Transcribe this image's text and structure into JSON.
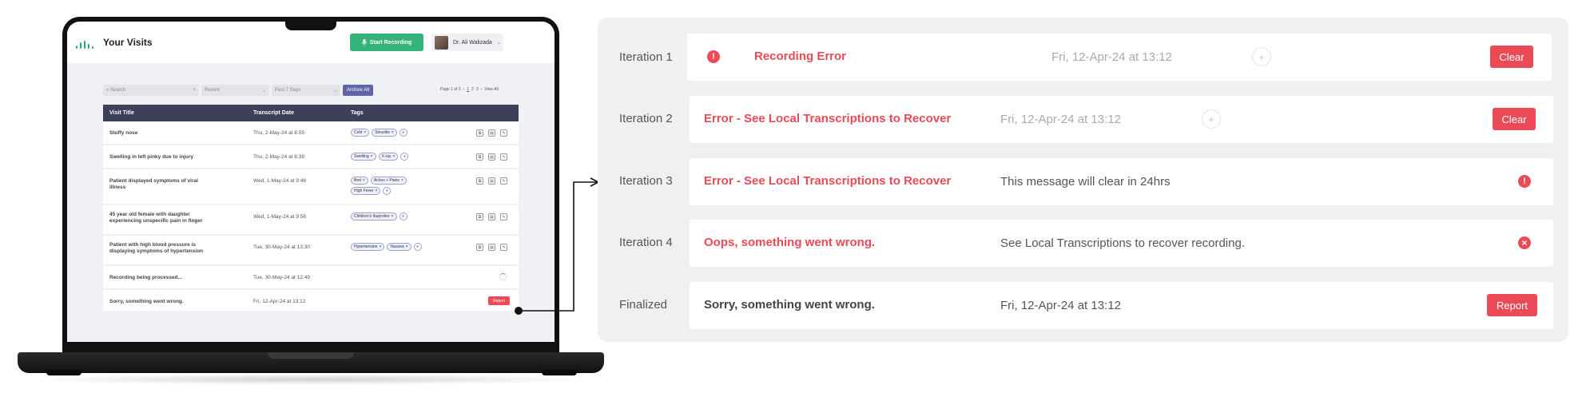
{
  "app": {
    "title": "Your Visits",
    "start_button": "Start Recording",
    "user_name": "Dr. Ali Walizada",
    "search_placeholder": "Search",
    "filter_sort": "Recent",
    "filter_range": "Past 7 Days",
    "archive_button": "Archive All",
    "pager": {
      "label": "Page 1 of 3",
      "pages": [
        "1",
        "2",
        "3"
      ],
      "view_all": "View All"
    },
    "columns": [
      "Visit Title",
      "Transcript Date",
      "Tags"
    ],
    "rows": [
      {
        "title": "Stuffy nose",
        "date": "Thu, 2-May-24 at 8:55",
        "tags": [
          "Cold",
          "Sinusitis"
        ]
      },
      {
        "title": "Swelling in left pinky due to injury",
        "date": "Thu, 2-May-24 at 8:39",
        "tags": [
          "Swelling",
          "X-ray"
        ]
      },
      {
        "title": "Patient displayed symptoms of viral illness",
        "date": "Wed, 1-May-24 at 9:46",
        "tags": [
          "Bed",
          "Aches + Pains",
          "High Fever"
        ]
      },
      {
        "title": "45 year old female with daughter experiencing unspecific pain in finger",
        "date": "Wed, 1-May-24 at 9:56",
        "tags": [
          "Children's Ibuprofen"
        ]
      },
      {
        "title": "Patient with high blood pressure is displaying symptoms of hypertension",
        "date": "Tue, 30-May-24 at 13:30",
        "tags": [
          "Hypertension",
          "Nausea"
        ]
      },
      {
        "title": "Recording being processed...",
        "date": "Tue, 30-May-24 at 12:49",
        "tags": []
      },
      {
        "title": "Sorry, something went wrong.",
        "date": "Fri, 12-Apr-24 at 13:12",
        "tags": [],
        "report": "Report"
      }
    ]
  },
  "iterations": [
    {
      "label": "Iteration 1",
      "title": "Recording Error",
      "date": "Fri, 12-Apr-24 at 13:12",
      "button": "Clear"
    },
    {
      "label": "Iteration 2",
      "title": "Error - See Local Transcriptions to Recover",
      "date": "Fri, 12-Apr-24 at 13:12",
      "button": "Clear"
    },
    {
      "label": "Iteration 3",
      "title": "Error - See Local Transcriptions to Recover",
      "message": "This message will clear in 24hrs"
    },
    {
      "label": "Iteration 4",
      "title": "Oops, something went wrong.",
      "message": "See Local Transcriptions to recover recording."
    },
    {
      "label": "Finalized",
      "title": "Sorry, something went wrong.",
      "date": "Fri, 12-Apr-24 at 13:12",
      "button": "Report"
    }
  ],
  "colors": {
    "error": "#ea4b56",
    "primary_green": "#35b47a",
    "header_dark": "#3d4059",
    "accent_indigo": "#5d66a8"
  },
  "icons": [
    "logo-waveform-icon",
    "microphone-icon",
    "chevron-down-icon",
    "search-icon",
    "clear-x-icon",
    "tag-remove-icon",
    "add-tag-icon",
    "copy-icon",
    "archive-icon",
    "edit-icon",
    "spinner-icon",
    "alert-icon",
    "close-circle-icon",
    "add-circle-icon"
  ]
}
